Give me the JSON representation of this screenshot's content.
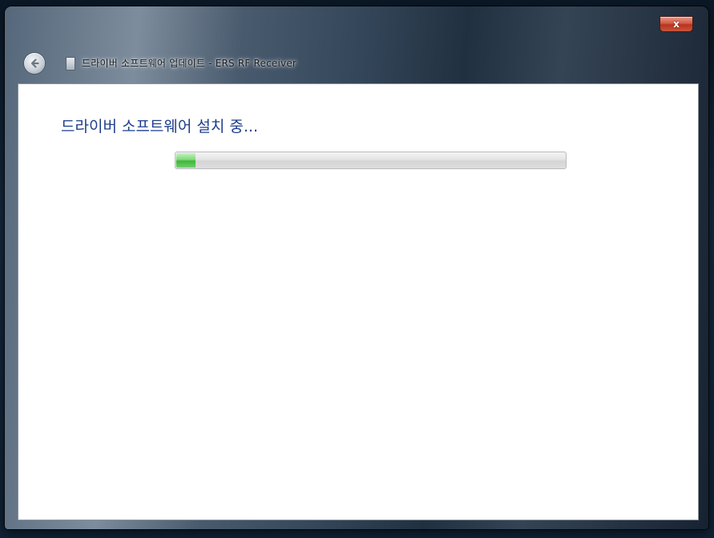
{
  "window": {
    "title": "드라이버 소프트웨어 업데이트 - ERS RF Receiver",
    "close_label": "x"
  },
  "main": {
    "heading": "드라이버 소프트웨어 설치 중..."
  },
  "progress": {
    "value_percent": 5,
    "color_fill": "#3fb63a"
  },
  "icons": {
    "back": "back-arrow-icon",
    "title": "device-icon",
    "close": "close-icon"
  }
}
